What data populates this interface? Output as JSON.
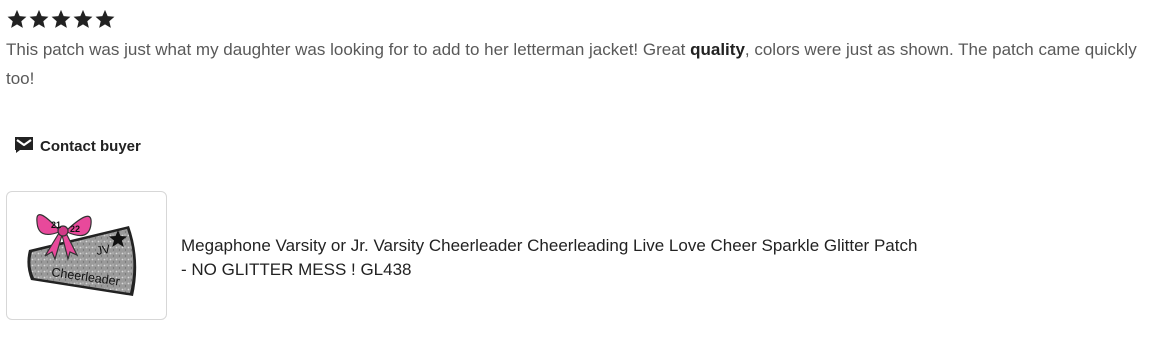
{
  "review": {
    "rating": 5,
    "rating_max": 5,
    "text_before": "This patch was just what my daughter was looking for to add to her letterman jacket! Great ",
    "text_bold": "quality",
    "text_after": ", colors were just as shown. The patch came quickly too!"
  },
  "contact": {
    "label": "Contact buyer",
    "icon": "envelope-icon"
  },
  "listing": {
    "image_text_year_left": "21",
    "image_text_year_right": "22",
    "image_text_level": "JV",
    "image_text_role": "Cheerleader",
    "title_line1": "Megaphone Varsity or Jr. Varsity Cheerleader Cheerleading Live Love Cheer Sparkle Glitter Patch",
    "title_line2": "- NO GLITTER MESS ! GL438"
  },
  "colors": {
    "star": "#222222",
    "text_muted": "#595959",
    "text_strong": "#222222",
    "bow_pink": "#e8499b",
    "glitter_gray": "#9a9a9a"
  }
}
